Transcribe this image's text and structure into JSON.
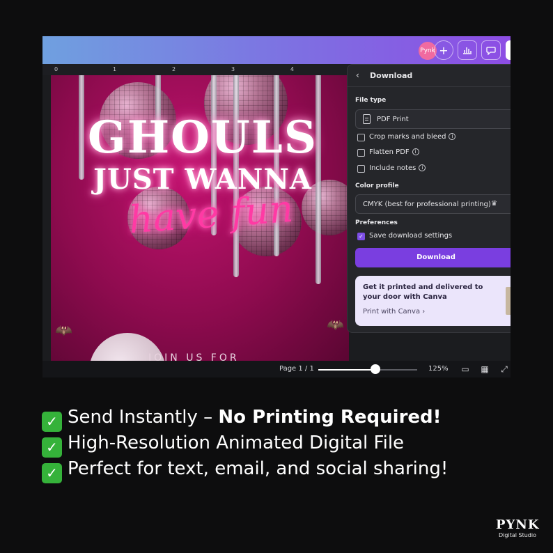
{
  "canva_window": {
    "topbar": {
      "avatar_text": "Pynk",
      "add_icon": "plus-icon",
      "stats_icon": "bar-chart-icon",
      "comment_icon": "comment-icon"
    },
    "ruler_marks": [
      "0",
      "1",
      "2",
      "3",
      "4"
    ],
    "design": {
      "headline_1": "GHOULS",
      "headline_2": "JUST WANNA",
      "headline_script": "have fun",
      "subtext": "JOIN US FOR"
    },
    "bottombar": {
      "page_indicator": "Page 1 / 1",
      "zoom_fraction": 0.58,
      "zoom_label": "125%"
    },
    "download_panel": {
      "title": "Download",
      "file_type_label": "File type",
      "file_type_value": "PDF Print",
      "options": [
        {
          "label": "Crop marks and bleed",
          "checked": false
        },
        {
          "label": "Flatten PDF",
          "checked": false
        },
        {
          "label": "Include notes",
          "checked": false
        }
      ],
      "color_profile_label": "Color profile",
      "color_profile_value": "CMYK (best for professional printing)",
      "preferences_label": "Preferences",
      "save_settings_label": "Save download settings",
      "save_settings_checked": true,
      "download_button": "Download",
      "promo_title": "Get it printed and delivered to your door with Canva",
      "promo_link": "Print with Canva"
    }
  },
  "features": [
    {
      "plain": "Send Instantly – ",
      "bold": "No Printing Required!"
    },
    {
      "plain": "High-Resolution Animated Digital File",
      "bold": ""
    },
    {
      "plain": "Perfect for text, email, and social sharing!",
      "bold": ""
    }
  ],
  "brand": {
    "name": "PYNK",
    "tagline": "Digital Studio"
  },
  "colors": {
    "background": "#0d0d0e",
    "accent_purple": "#7a3ee0",
    "check_green": "#35b23a",
    "neon_pink": "#ff3aa4"
  }
}
